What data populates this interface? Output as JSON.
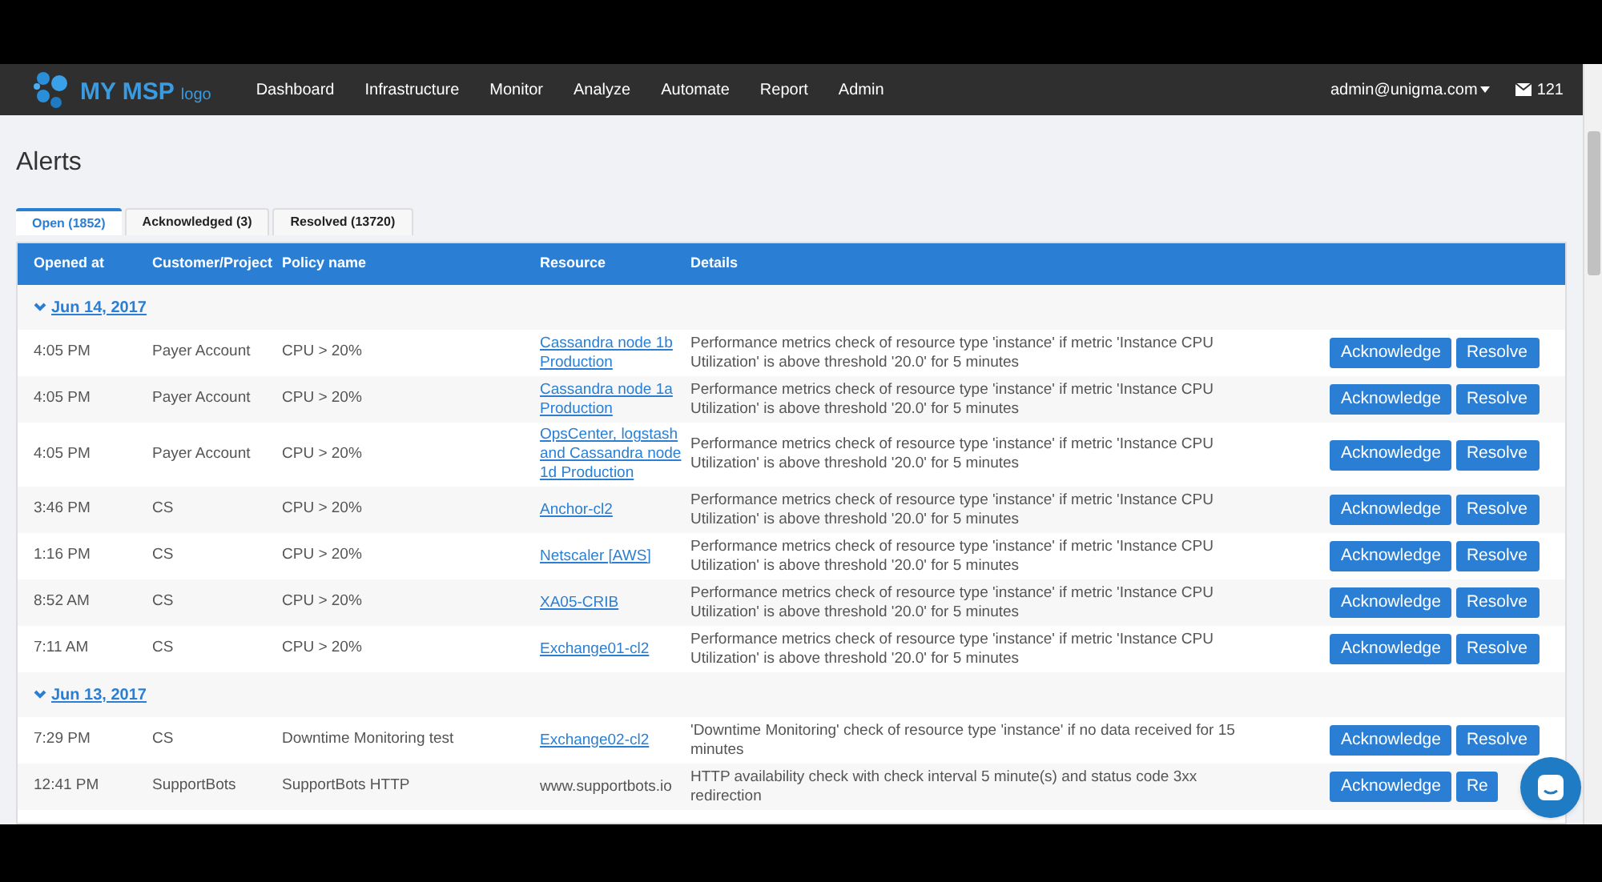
{
  "navbar": {
    "logo": {
      "name": "MY MSP",
      "suffix": "logo"
    },
    "menu": [
      "Dashboard",
      "Infrastructure",
      "Monitor",
      "Analyze",
      "Automate",
      "Report",
      "Admin"
    ],
    "user": "admin@unigma.com",
    "messages": "121"
  },
  "page_title": "Alerts",
  "tabs": [
    {
      "label": "Open (1852)",
      "selected": true
    },
    {
      "label": "Acknowledged (3)",
      "selected": false
    },
    {
      "label": "Resolved (13720)",
      "selected": false
    }
  ],
  "table": {
    "columns": [
      "Opened at",
      "Customer/Project",
      "Policy name",
      "Resource",
      "Details"
    ],
    "groups": [
      {
        "date": "Jun 14, 2017",
        "expanded": true,
        "rows": [
          {
            "time": "4:05 PM",
            "customer": "Payer Account",
            "policy": "CPU > 20%",
            "resource": "Cassandra node 1b Production",
            "resource_link": true,
            "details": "Performance metrics check of resource type 'instance' if metric 'Instance CPU Utilization' is above threshold '20.0' for 5 minutes",
            "actions": [
              "Acknowledge",
              "Resolve"
            ]
          },
          {
            "time": "4:05 PM",
            "customer": "Payer Account",
            "policy": "CPU > 20%",
            "resource": "Cassandra node 1a Production",
            "resource_link": true,
            "details": "Performance metrics check of resource type 'instance' if metric 'Instance CPU Utilization' is above threshold '20.0' for 5 minutes",
            "actions": [
              "Acknowledge",
              "Resolve"
            ]
          },
          {
            "time": "4:05 PM",
            "customer": "Payer Account",
            "policy": "CPU > 20%",
            "resource": "OpsCenter, logstash and Cassandra node 1d Production",
            "resource_link": true,
            "details": "Performance metrics check of resource type 'instance' if metric 'Instance CPU Utilization' is above threshold '20.0' for 5 minutes",
            "actions": [
              "Acknowledge",
              "Resolve"
            ]
          },
          {
            "time": "3:46 PM",
            "customer": "CS",
            "policy": "CPU > 20%",
            "resource": "Anchor-cl2",
            "resource_link": true,
            "details": "Performance metrics check of resource type 'instance' if metric 'Instance CPU Utilization' is above threshold '20.0' for 5 minutes",
            "actions": [
              "Acknowledge",
              "Resolve"
            ]
          },
          {
            "time": "1:16 PM",
            "customer": "CS",
            "policy": "CPU > 20%",
            "resource": "Netscaler [AWS]",
            "resource_link": true,
            "details": "Performance metrics check of resource type 'instance' if metric 'Instance CPU Utilization' is above threshold '20.0' for 5 minutes",
            "actions": [
              "Acknowledge",
              "Resolve"
            ]
          },
          {
            "time": "8:52 AM",
            "customer": "CS",
            "policy": "CPU > 20%",
            "resource": "XA05-CRIB",
            "resource_link": true,
            "details": "Performance metrics check of resource type 'instance' if metric 'Instance CPU Utilization' is above threshold '20.0' for 5 minutes",
            "actions": [
              "Acknowledge",
              "Resolve"
            ]
          },
          {
            "time": "7:11 AM",
            "customer": "CS",
            "policy": "CPU > 20%",
            "resource": "Exchange01-cl2",
            "resource_link": true,
            "details": "Performance metrics check of resource type 'instance' if metric 'Instance CPU Utilization' is above threshold '20.0' for 5 minutes",
            "actions": [
              "Acknowledge",
              "Resolve"
            ]
          }
        ]
      },
      {
        "date": "Jun 13, 2017",
        "expanded": true,
        "rows": [
          {
            "time": "7:29 PM",
            "customer": "CS",
            "policy": "Downtime Monitoring test",
            "resource": "Exchange02-cl2",
            "resource_link": true,
            "details": "'Downtime Monitoring' check of resource type 'instance' if no data received for 15 minutes",
            "actions": [
              "Acknowledge",
              "Resolve"
            ]
          },
          {
            "time": "12:41 PM",
            "customer": "SupportBots",
            "policy": "SupportBots HTTP",
            "resource": "www.supportbots.io",
            "resource_link": false,
            "details": "HTTP availability check with check interval 5 minute(s) and status code 3xx redirection",
            "actions": [
              "Acknowledge",
              "Re"
            ]
          }
        ]
      }
    ]
  }
}
